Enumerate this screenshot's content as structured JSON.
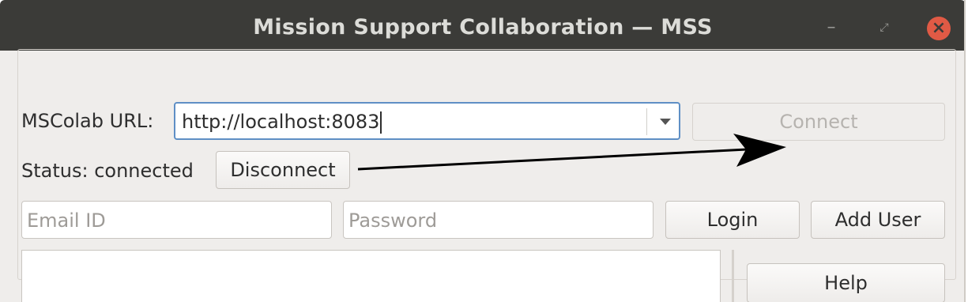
{
  "window": {
    "title": "Mission Support Collaboration — MSS",
    "minimize_glyph": "–",
    "restore_glyph": "⤢",
    "close_glyph": "×"
  },
  "connection": {
    "url_label": "MSColab URL:",
    "url_value": "http://localhost:8083",
    "connect_label": "Connect",
    "status_text": "Status: connected",
    "disconnect_label": "Disconnect"
  },
  "login": {
    "email_placeholder": "Email ID",
    "password_placeholder": "Password",
    "login_label": "Login",
    "add_user_label": "Add User"
  },
  "side": {
    "help_label": "Help"
  },
  "annotation": {
    "arrow_color": "#000000",
    "description_icon": "arrow-right-icon"
  },
  "colors": {
    "titlebar": "#3b3b38",
    "close_button": "#e05a45",
    "focus_border": "#5f8fc5",
    "window_bg": "#efedeb"
  }
}
